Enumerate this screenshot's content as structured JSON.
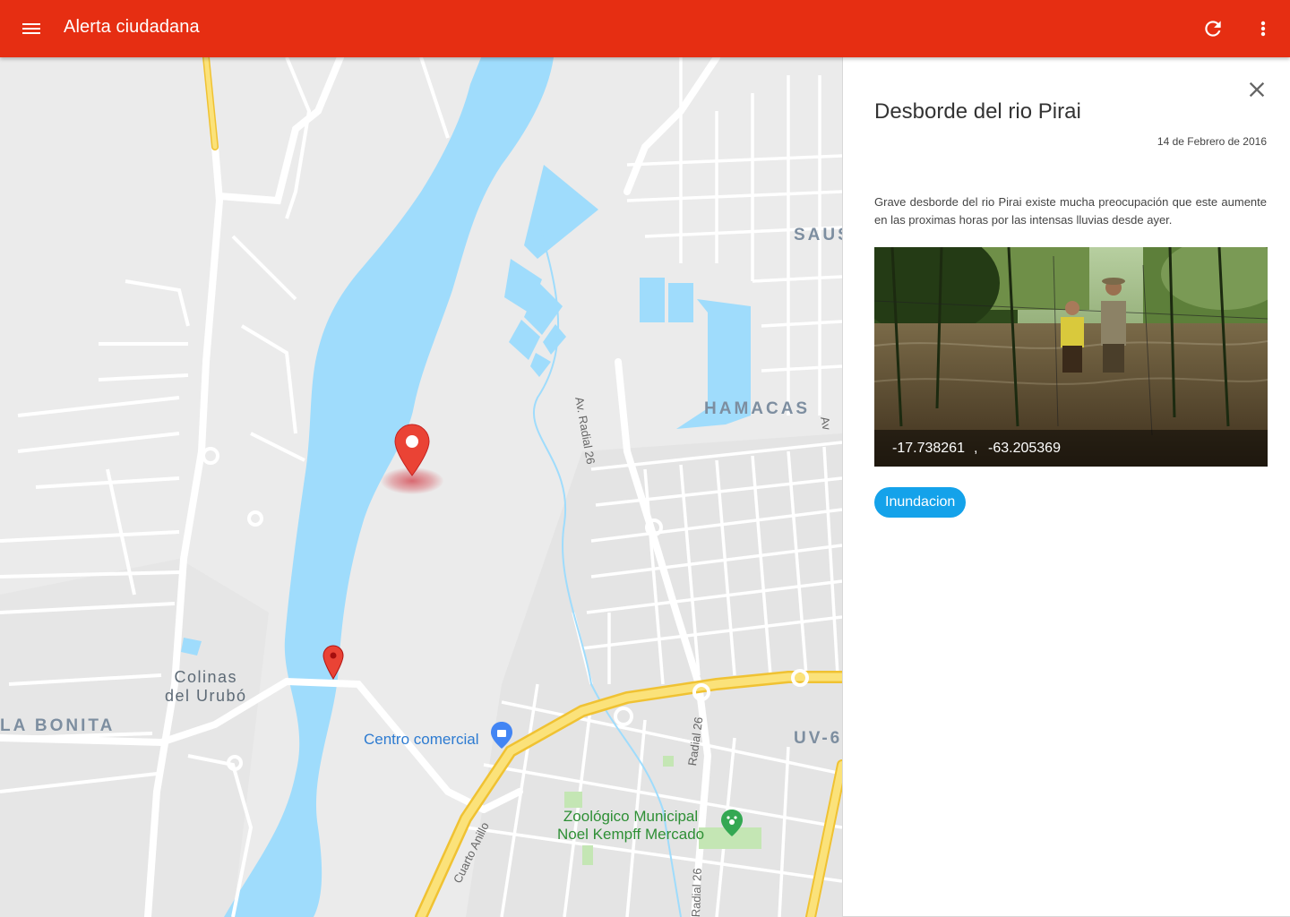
{
  "app": {
    "title": "Alerta ciudadana",
    "accent_color": "#e62e12",
    "icons": [
      "menu-icon",
      "refresh-icon",
      "more-vert-icon"
    ]
  },
  "map": {
    "labels": {
      "sausal": "SAUS",
      "hamacas": "HAMACAS",
      "la_bonita": "LA BONITA",
      "uv": "UV-6",
      "colinas_line1": "Colinas",
      "colinas_line2": "del Urubó",
      "centro_comercial": "Centro comercial",
      "zoo_line1": "Zoológico Municipal",
      "zoo_line2": "Noel Kempff Mercado",
      "radial_26_a": "Av. Radial 26",
      "radial_26_b": "Radial 26",
      "radial_26_c": "Radial 26",
      "cuarto_anillo": "Cuarto Anillo",
      "av_partial": "Av"
    },
    "colors": {
      "water": "#9fdcfc",
      "land": "#ebebeb",
      "road": "#ffffff",
      "highway": "#f7d454"
    },
    "markers": [
      "map-marker-selected",
      "map-marker"
    ]
  },
  "panel": {
    "title": "Desborde del rio Pirai",
    "date": "14 de Febrero de 2016",
    "description": "Grave desborde del rio Pirai existe mucha preocupación que este aumente en las proximas horas por las intensas lluvias desde ayer.",
    "latitude": "-17.738261",
    "separator": ",",
    "longitude": "-63.205369",
    "tag": "Inundacion",
    "tag_color": "#14a2ea"
  }
}
